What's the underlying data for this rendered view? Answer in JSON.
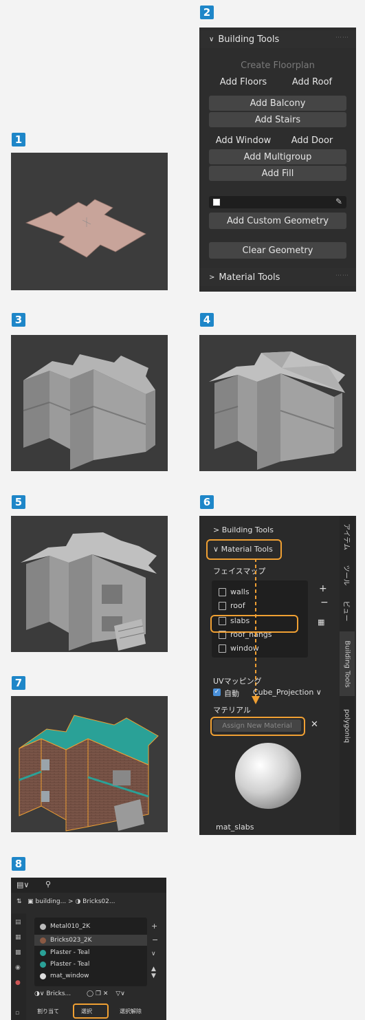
{
  "steps": {
    "s1": "1",
    "s2": "2",
    "s3": "3",
    "s4": "4",
    "s5": "5",
    "s6": "6",
    "s7": "7",
    "s8": "8"
  },
  "building_tools": {
    "header": "Building Tools",
    "create_floorplan": "Create Floorplan",
    "add_floors": "Add Floors",
    "add_roof": "Add Roof",
    "add_balcony": "Add Balcony",
    "add_stairs": "Add Stairs",
    "add_window": "Add Window",
    "add_door": "Add Door",
    "add_multigroup": "Add Multigroup",
    "add_fill": "Add Fill",
    "add_custom_geometry": "Add Custom Geometry",
    "clear_geometry": "Clear Geometry",
    "material_tools": "Material Tools"
  },
  "material_panel": {
    "building_tools": "Building Tools",
    "material_tools": "Material Tools",
    "face_maps_label": "フェイスマップ",
    "face_maps": [
      "walls",
      "roof",
      "slabs",
      "roof_hangs",
      "window"
    ],
    "uv_label": "UVマッピング",
    "auto_label": "自動",
    "projection": "Cube_Projection",
    "material_label": "マテリアル",
    "assign_button": "Assign New Material",
    "material_name": "mat_slabs",
    "tabs": [
      "アイテム",
      "ツール",
      "ビュー",
      "Building Tools",
      "polygoniq"
    ]
  },
  "material_list": {
    "breadcrumb_obj": "building...",
    "breadcrumb_mat": "Bricks02...",
    "items": [
      "Metal010_2K",
      "Bricks023_2K",
      "Plaster - Teal",
      "Plaster - Teal",
      "mat_window"
    ],
    "slot_name": "Bricks...",
    "assign": "割り当て",
    "select": "選択",
    "deselect": "選択解除"
  },
  "colors": {
    "accent_badge": "#1e86c8",
    "highlight": "#f0a033",
    "viewport_bg": "#3a3a3a",
    "teal_roof": "#2aa197"
  }
}
